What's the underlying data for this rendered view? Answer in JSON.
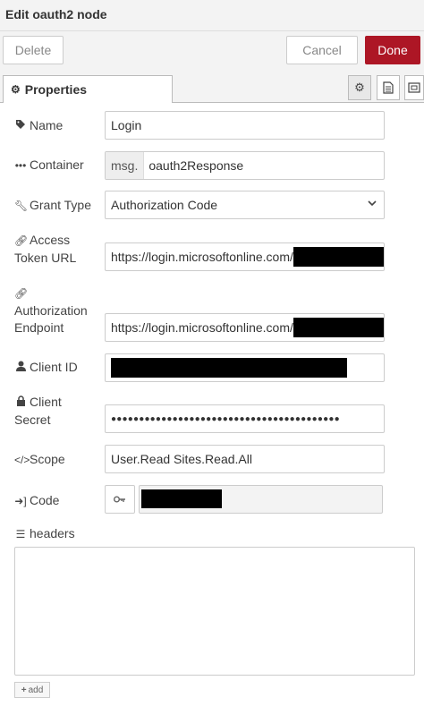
{
  "header": {
    "title": "Edit oauth2 node"
  },
  "toolbar": {
    "delete_label": "Delete",
    "cancel_label": "Cancel",
    "done_label": "Done"
  },
  "tabs": {
    "properties_label": "Properties"
  },
  "fields": {
    "name": {
      "label": "Name",
      "value": "Login"
    },
    "container": {
      "label": "Container",
      "prefix": "msg.",
      "value": "oauth2Response"
    },
    "grant_type": {
      "label": "Grant Type",
      "value": "Authorization Code"
    },
    "access_token_url": {
      "label_line1": "Access",
      "label_line2": "Token URL",
      "value": "https://login.microsoftonline.com/"
    },
    "authorization_endpoint": {
      "label_line1": "Authorization",
      "label_line2": "Endpoint",
      "value": "https://login.microsoftonline.com/"
    },
    "client_id": {
      "label": "Client ID"
    },
    "client_secret": {
      "label_line1": "Client",
      "label_line2": "Secret",
      "value": "●●●●●●●●●●●●●●●●●●●●●●●●●●●●●●●●●●●●●●●●●"
    },
    "scope": {
      "label": "Scope",
      "value": "User.Read Sites.Read.All"
    },
    "code": {
      "label": "Code"
    },
    "headers": {
      "label": "headers",
      "add_label": "add"
    }
  },
  "icons": {
    "name": "tag-icon",
    "container": "ellipsis-icon",
    "grant_type": "wrench-icon",
    "access_token_url": "link-icon",
    "authorization_endpoint": "link-icon",
    "client_id": "user-icon",
    "client_secret": "lock-icon",
    "scope": "code-icon",
    "code": "sign-in-icon",
    "headers": "list-icon"
  }
}
